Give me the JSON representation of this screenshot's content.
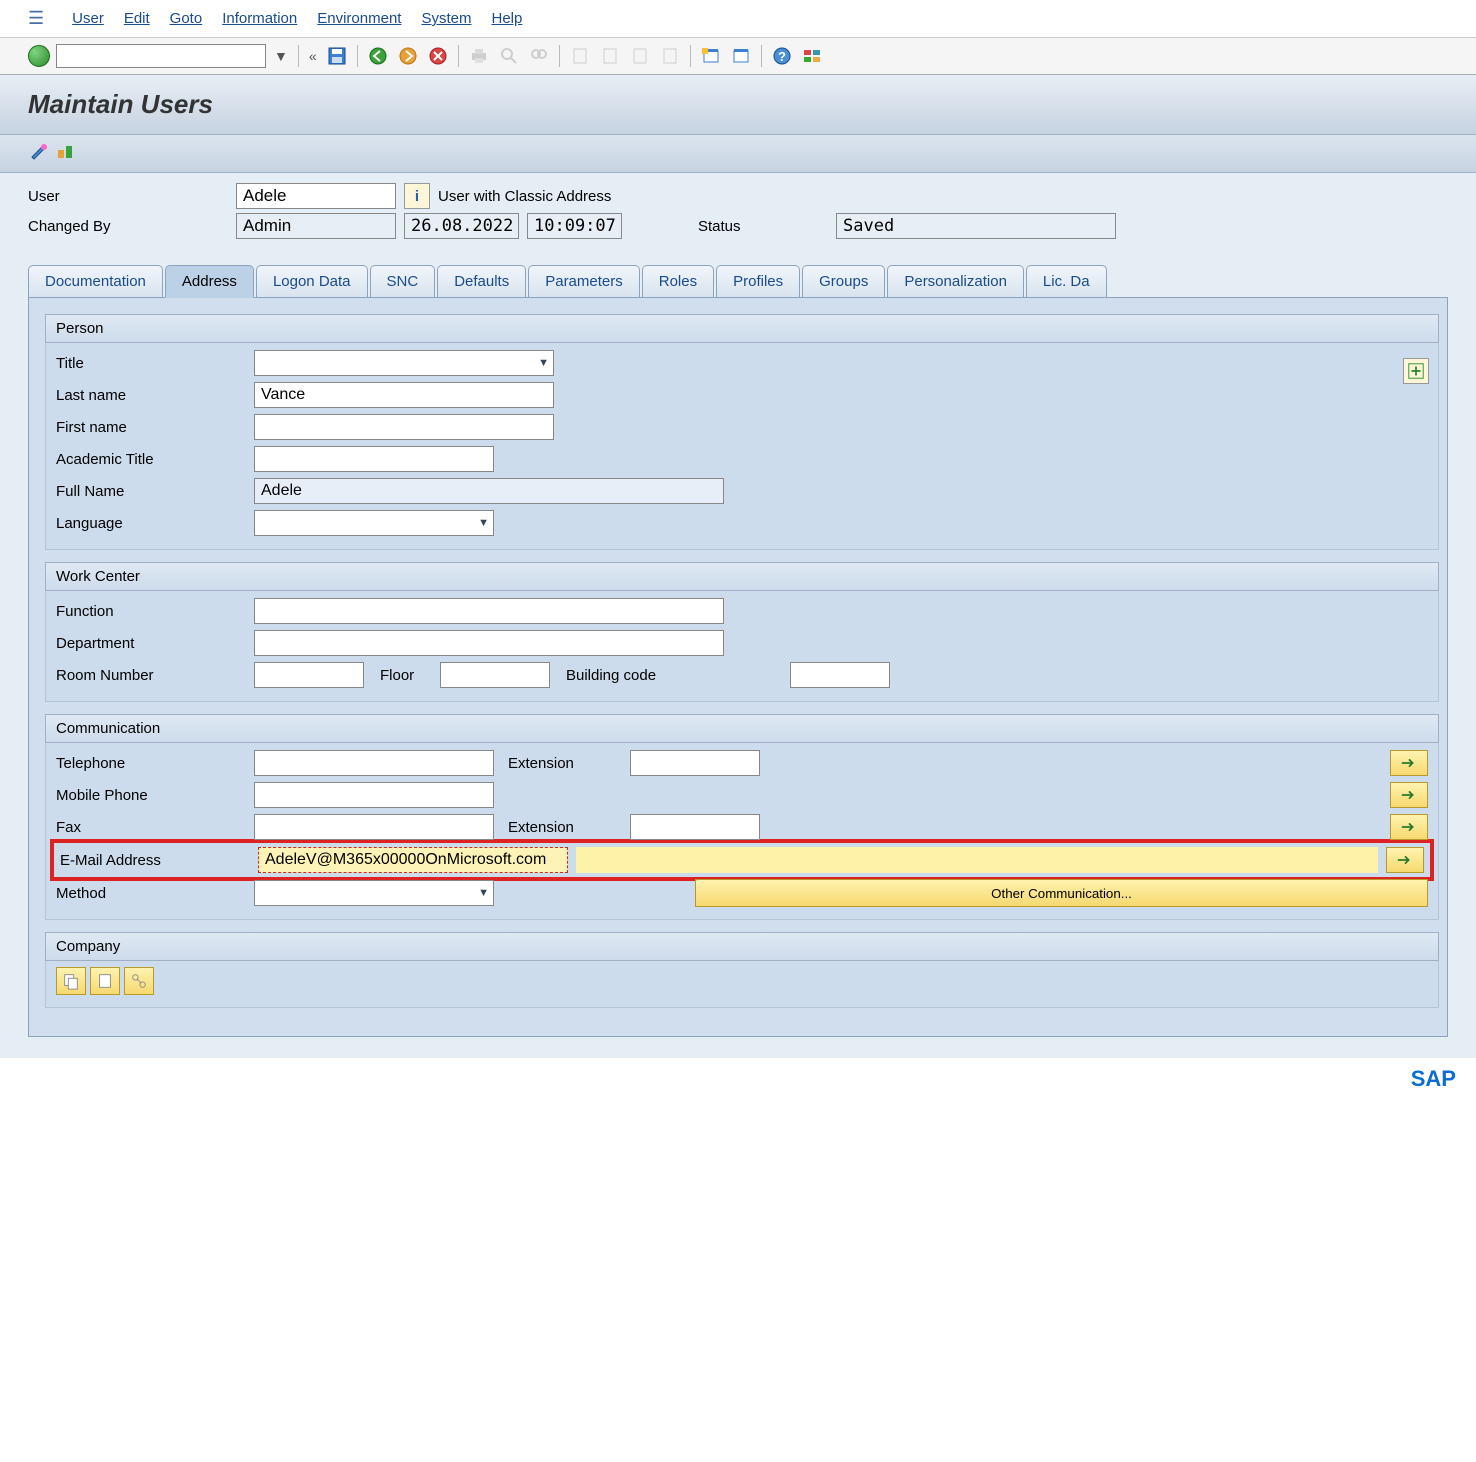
{
  "menu": {
    "user": "User",
    "edit": "Edit",
    "goto": "Goto",
    "info": "Information",
    "env": "Environment",
    "system": "System",
    "help": "Help"
  },
  "page_title": "Maintain Users",
  "header": {
    "user_label": "User",
    "user_value": "Adele",
    "classic_text": "User with Classic Address",
    "changed_by_label": "Changed By",
    "changed_by_value": "Admin",
    "changed_date": "26.08.2022",
    "changed_time": "10:09:07",
    "status_label": "Status",
    "status_value": "Saved"
  },
  "tabs": [
    "Documentation",
    "Address",
    "Logon Data",
    "SNC",
    "Defaults",
    "Parameters",
    "Roles",
    "Profiles",
    "Groups",
    "Personalization",
    "Lic. Da"
  ],
  "person": {
    "group": "Person",
    "title_label": "Title",
    "last_name_label": "Last name",
    "last_name": "Vance",
    "first_name_label": "First name",
    "first_name": "",
    "acad_label": "Academic Title",
    "acad": "",
    "full_name_label": "Full Name",
    "full_name": "Adele",
    "lang_label": "Language"
  },
  "work": {
    "group": "Work Center",
    "function_label": "Function",
    "dept_label": "Department",
    "room_label": "Room Number",
    "floor_label": "Floor",
    "building_label": "Building code"
  },
  "comm": {
    "group": "Communication",
    "tel_label": "Telephone",
    "ext_label": "Extension",
    "mobile_label": "Mobile Phone",
    "fax_label": "Fax",
    "email_label": "E-Mail Address",
    "email": "AdeleV@M365x00000OnMicrosoft.com",
    "method_label": "Method",
    "other_label": "Other Communication..."
  },
  "company": {
    "group": "Company"
  }
}
